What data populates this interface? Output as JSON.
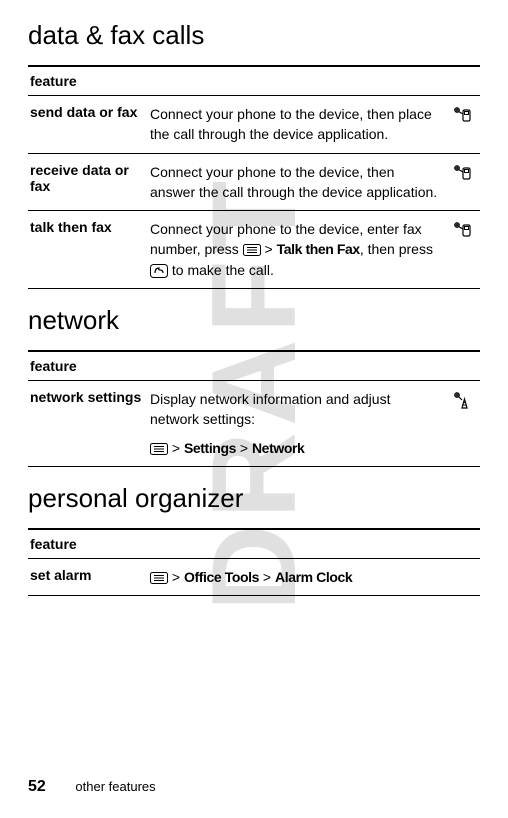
{
  "watermark": "DRAFT",
  "sections": [
    {
      "heading": "data & fax calls",
      "header_label": "feature",
      "rows": [
        {
          "label": "send data or fax",
          "icon": "data-connect",
          "parts": [
            {
              "t": "text",
              "v": "Connect your phone to the device, then place the call through the device application."
            }
          ]
        },
        {
          "label": "receive data or fax",
          "icon": "data-connect",
          "parts": [
            {
              "t": "text",
              "v": "Connect your phone to the device, then answer the call through the device application."
            }
          ]
        },
        {
          "label": "talk then fax",
          "icon": "data-connect",
          "parts": [
            {
              "t": "text",
              "v": "Connect your phone to the device, enter fax number, press "
            },
            {
              "t": "menukey"
            },
            {
              "t": "text",
              "v": " > "
            },
            {
              "t": "condbold",
              "v": "Talk then Fax"
            },
            {
              "t": "text",
              "v": ", then press "
            },
            {
              "t": "sendkey"
            },
            {
              "t": "text",
              "v": " to make the call."
            }
          ]
        }
      ]
    },
    {
      "heading": "network",
      "header_label": "feature",
      "rows": [
        {
          "label": "network settings",
          "icon": "network",
          "parts": [
            {
              "t": "text",
              "v": "Display network information and adjust network settings:"
            },
            {
              "t": "break"
            },
            {
              "t": "menukey"
            },
            {
              "t": "text",
              "v": " > "
            },
            {
              "t": "condbold",
              "v": "Settings"
            },
            {
              "t": "text",
              "v": " > "
            },
            {
              "t": "condbold",
              "v": "Network"
            }
          ]
        }
      ]
    },
    {
      "heading": "personal organizer",
      "header_label": "feature",
      "rows": [
        {
          "label": "set alarm",
          "icon": null,
          "parts": [
            {
              "t": "menukey"
            },
            {
              "t": "text",
              "v": " > "
            },
            {
              "t": "condbold",
              "v": "Office Tools"
            },
            {
              "t": "text",
              "v": " > "
            },
            {
              "t": "condbold",
              "v": "Alarm Clock"
            }
          ]
        }
      ]
    }
  ],
  "footer": {
    "page_number": "52",
    "section_name": "other features"
  }
}
